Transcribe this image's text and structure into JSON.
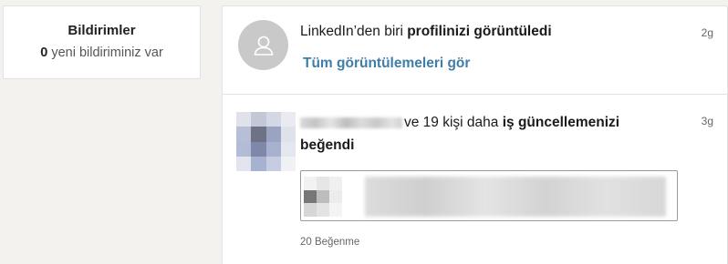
{
  "summary": {
    "title": "Bildirimler",
    "count": "0",
    "count_suffix": "yeni bildiriminiz var"
  },
  "notifications": [
    {
      "text_prefix": "LinkedIn’den biri ",
      "text_strong": "profilinizi görüntüledi",
      "link_label": "Tüm görüntülemeleri gör",
      "time": "2g"
    },
    {
      "text_prefix": "ve 19 kişi daha ",
      "text_strong": "iş güncellemenizi beğendi",
      "time": "3g",
      "likes_label": "20 Beğenme"
    }
  ],
  "colors": {
    "link": "#3f7ea8",
    "avatar_placeholder": "#c9c9c9",
    "panel_border": "#e2e2e2"
  },
  "icons": {
    "profile_placeholder": "person-icon"
  }
}
